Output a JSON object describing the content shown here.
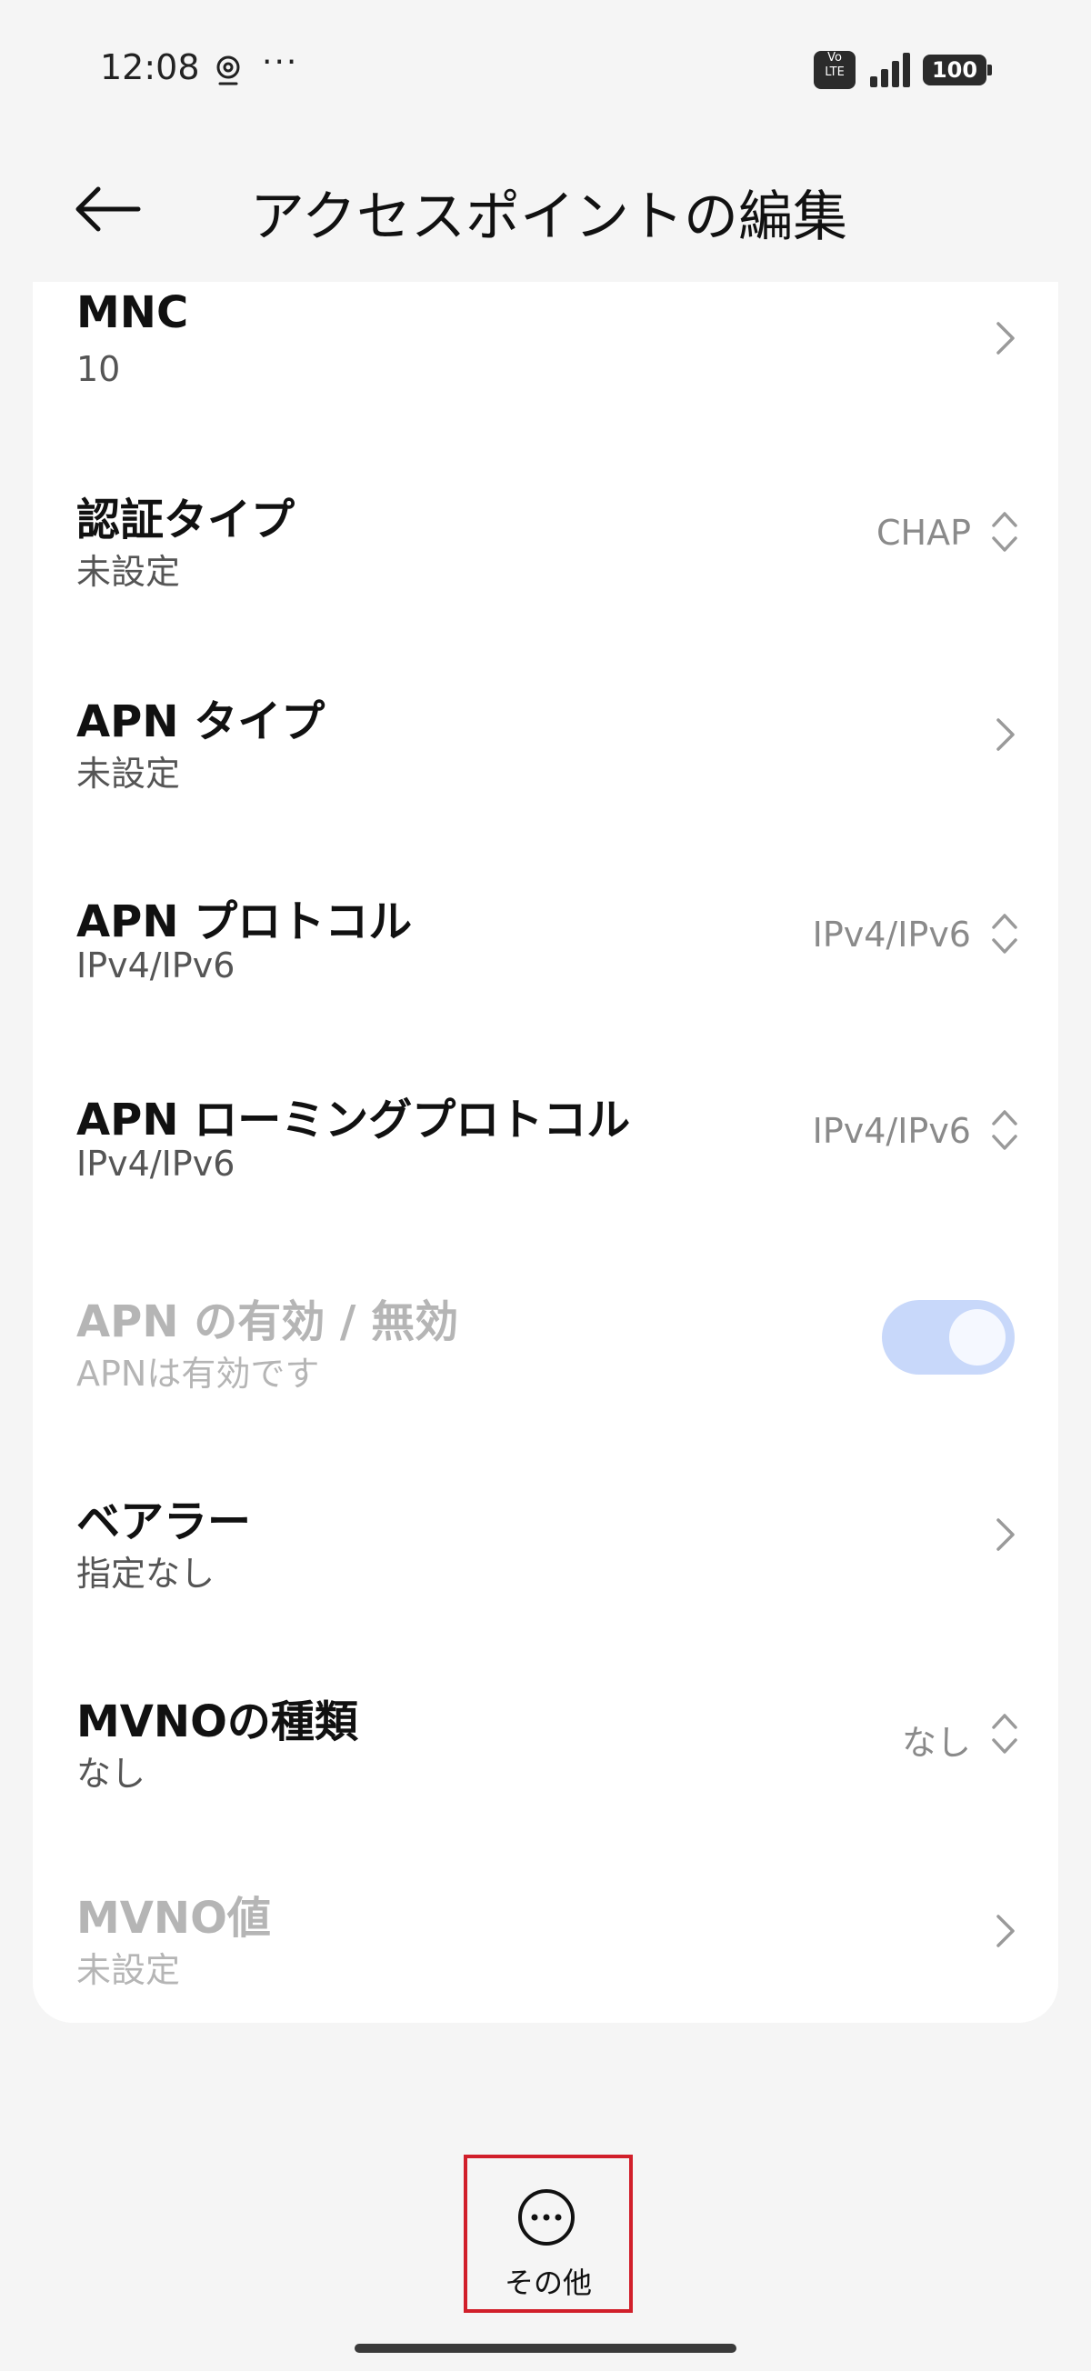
{
  "status_bar": {
    "time": "12:08",
    "more": "···",
    "volte_top": "Vo",
    "volte_bottom": "LTE",
    "battery": "100"
  },
  "header": {
    "title": "アクセスポイントの編集",
    "back_icon": "arrow-left-icon"
  },
  "rows": [
    {
      "title": "MNC",
      "subtitle": "10",
      "control": "chevron"
    },
    {
      "title": "認証タイプ",
      "subtitle": "未設定",
      "value": "CHAP",
      "control": "updown"
    },
    {
      "title": "APN タイプ",
      "subtitle": "未設定",
      "control": "chevron"
    },
    {
      "title": "APN プロトコル",
      "subtitle": "IPv4/IPv6",
      "value": "IPv4/IPv6",
      "control": "updown"
    },
    {
      "title": "APN ローミングプロトコル",
      "subtitle": "IPv4/IPv6",
      "value": "IPv4/IPv6",
      "control": "updown"
    },
    {
      "title": "APN の有効 / 無効",
      "subtitle": "APNは有効です",
      "control": "toggle",
      "enabled": false,
      "toggle_on": true
    },
    {
      "title": "ベアラー",
      "subtitle": "指定なし",
      "control": "chevron"
    },
    {
      "title": "MVNOの種類",
      "subtitle": "なし",
      "value": "なし",
      "control": "updown"
    },
    {
      "title": "MVNO値",
      "subtitle": "未設定",
      "control": "chevron",
      "enabled": false
    }
  ],
  "bottom": {
    "more_label": "その他",
    "more_icon": "more-horizontal-circle-icon"
  },
  "colors": {
    "background": "#f5f5f5",
    "card": "#ffffff",
    "toggle_track": "#c8d8fa",
    "highlight_border": "#d11f2a"
  }
}
